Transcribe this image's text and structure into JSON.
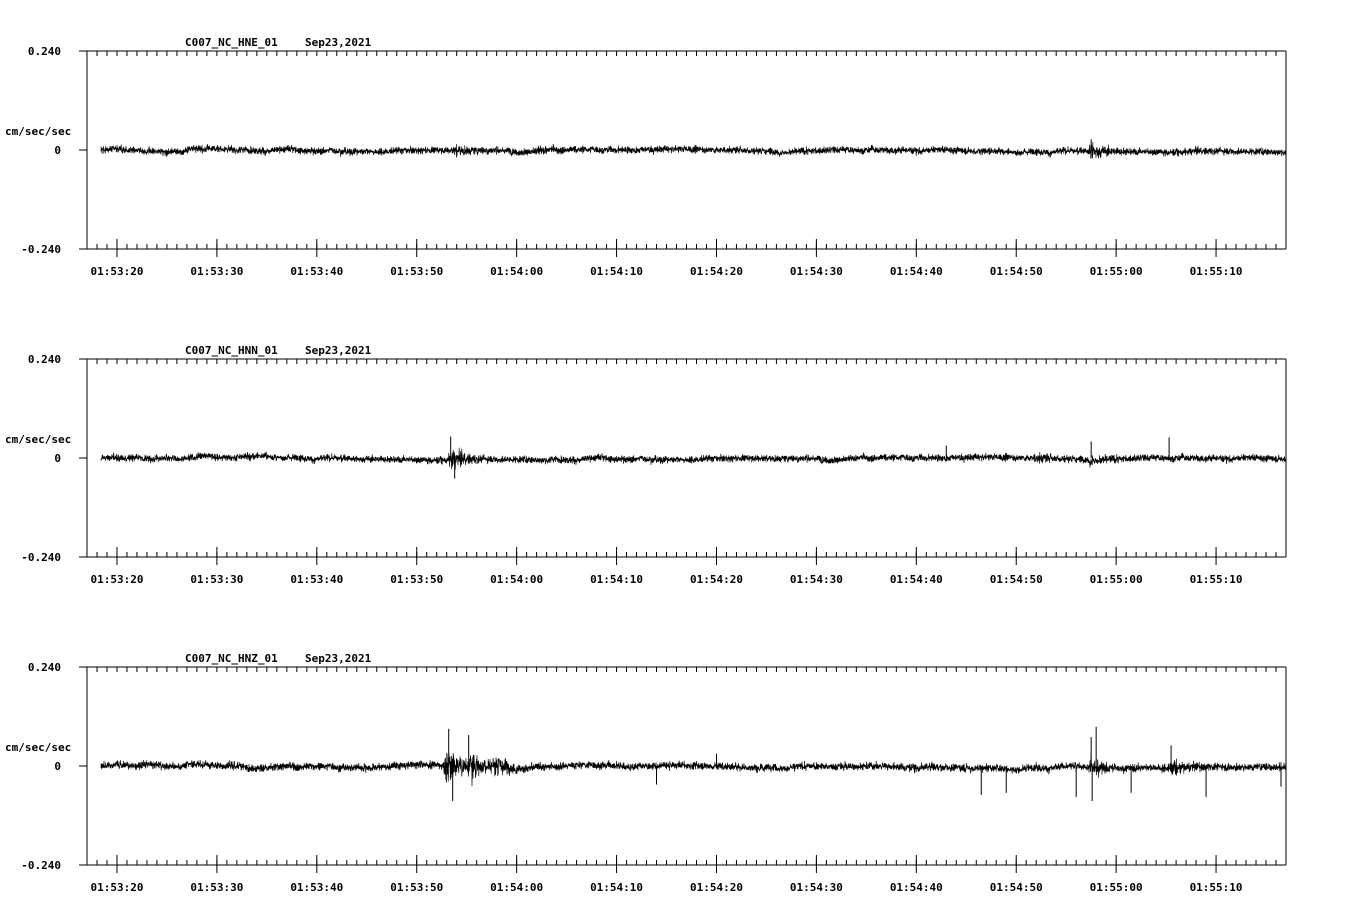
{
  "colors": {
    "background": "#ffffff",
    "trace": "#000000",
    "axis": "#000000"
  },
  "chart_data": [
    {
      "type": "line",
      "title": "C007_NC_HNE_01",
      "date": "Sep23,2021",
      "ylabel": "cm/sec/sec",
      "ylim": [
        -0.24,
        0.24
      ],
      "yticks": [
        "0.240",
        "0",
        "-0.240"
      ],
      "xlim": [
        "01:53:17",
        "01:55:17"
      ],
      "xticks": [
        "01:53:20",
        "01:53:30",
        "01:53:40",
        "01:53:50",
        "01:54:00",
        "01:54:10",
        "01:54:20",
        "01:54:30",
        "01:54:40",
        "01:54:50",
        "01:55:00",
        "01:55:10"
      ],
      "trace_start": "01:53:18.4",
      "trace_end": "01:55:17",
      "noise_amplitude": 0.011,
      "events": [
        {
          "time": "01:53:54",
          "amplitude": 0.008
        },
        {
          "time": "01:54:02",
          "amplitude": 0.006
        },
        {
          "time": "01:54:57.5",
          "amplitude": 0.02
        }
      ],
      "spikes": [
        {
          "time": "01:54:57.5",
          "value": 0.026
        },
        {
          "time": "01:54:57.6",
          "value": -0.02
        },
        {
          "time": "01:53:54",
          "value": -0.018
        }
      ]
    },
    {
      "type": "line",
      "title": "C007_NC_HNN_01",
      "date": "Sep23,2021",
      "ylabel": "cm/sec/sec",
      "ylim": [
        -0.24,
        0.24
      ],
      "yticks": [
        "0.240",
        "0",
        "-0.240"
      ],
      "xlim": [
        "01:53:17",
        "01:55:17"
      ],
      "xticks": [
        "01:53:20",
        "01:53:30",
        "01:53:40",
        "01:53:50",
        "01:54:00",
        "01:54:10",
        "01:54:20",
        "01:54:30",
        "01:54:40",
        "01:54:50",
        "01:55:00",
        "01:55:10"
      ],
      "trace_start": "01:53:18.4",
      "trace_end": "01:55:17",
      "noise_amplitude": 0.011,
      "events": [
        {
          "time": "01:53:53.5",
          "amplitude": 0.025
        },
        {
          "time": "01:54:52",
          "amplitude": 0.008
        },
        {
          "time": "01:54:57.5",
          "amplitude": 0.01
        }
      ],
      "spikes": [
        {
          "time": "01:53:53.4",
          "value": 0.052
        },
        {
          "time": "01:53:53.8",
          "value": -0.05
        },
        {
          "time": "01:54:57.5",
          "value": 0.04
        },
        {
          "time": "01:55:05.3",
          "value": 0.05
        },
        {
          "time": "01:54:43",
          "value": 0.03
        }
      ]
    },
    {
      "type": "line",
      "title": "C007_NC_HNZ_01",
      "date": "Sep23,2021",
      "ylabel": "cm/sec/sec",
      "ylim": [
        -0.24,
        0.24
      ],
      "yticks": [
        "0.240",
        "0",
        "-0.240"
      ],
      "xlim": [
        "01:53:17",
        "01:55:17"
      ],
      "xticks": [
        "01:53:20",
        "01:53:30",
        "01:53:40",
        "01:53:50",
        "01:54:00",
        "01:54:10",
        "01:54:20",
        "01:54:30",
        "01:54:40",
        "01:54:50",
        "01:55:00",
        "01:55:10"
      ],
      "trace_start": "01:53:18.4",
      "trace_end": "01:55:17",
      "noise_amplitude": 0.012,
      "events": [
        {
          "time": "01:53:53",
          "amplitude": 0.06
        },
        {
          "time": "01:53:55.5",
          "amplitude": 0.035
        },
        {
          "time": "01:53:58",
          "amplitude": 0.022
        },
        {
          "time": "01:54:57.5",
          "amplitude": 0.02
        },
        {
          "time": "01:55:05.5",
          "amplitude": 0.015
        }
      ],
      "spikes": [
        {
          "time": "01:53:53.2",
          "value": 0.09
        },
        {
          "time": "01:53:53.6",
          "value": -0.085
        },
        {
          "time": "01:53:55.2",
          "value": 0.075
        },
        {
          "time": "01:54:57.5",
          "value": 0.07
        },
        {
          "time": "01:54:57.6",
          "value": -0.085
        },
        {
          "time": "01:54:58",
          "value": 0.095
        },
        {
          "time": "01:54:56",
          "value": -0.075
        },
        {
          "time": "01:54:46.5",
          "value": -0.07
        },
        {
          "time": "01:54:49",
          "value": -0.065
        },
        {
          "time": "01:55:01.5",
          "value": -0.065
        },
        {
          "time": "01:55:09",
          "value": -0.075
        },
        {
          "time": "01:55:05.5",
          "value": 0.05
        },
        {
          "time": "01:55:16.5",
          "value": -0.05
        },
        {
          "time": "01:54:14",
          "value": -0.045
        },
        {
          "time": "01:54:20",
          "value": 0.03
        }
      ]
    }
  ]
}
